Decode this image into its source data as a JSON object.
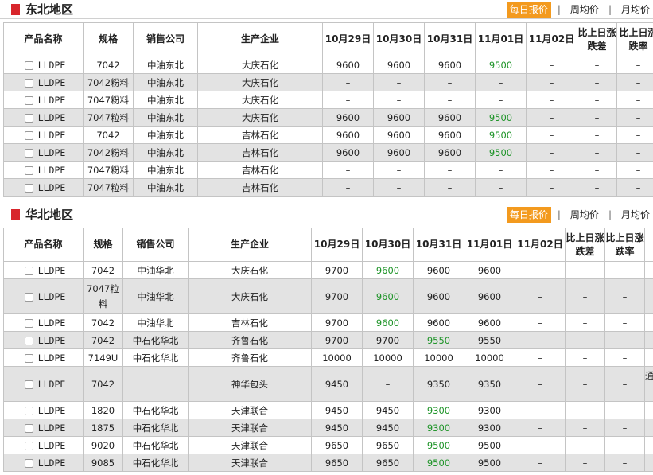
{
  "tabs": {
    "daily": "每日报价",
    "weekly": "周均价",
    "monthly": "月均价",
    "sep": "|"
  },
  "columns": [
    "产品名称",
    "规格",
    "销售公司",
    "生产企业",
    "10月29日",
    "10月30日",
    "10月31日",
    "11月01日",
    "11月02日",
    "比上日涨跌差",
    "比上日涨跌率"
  ],
  "colors": {
    "accent": "#f39a1e",
    "marker": "#d8262c",
    "up_down": "#1e9428",
    "row_alt": "#e3e3e3"
  },
  "sections": [
    {
      "title": "东北地区",
      "rows": [
        {
          "product": "LLDPE",
          "spec": "7042",
          "seller": "中油东北",
          "producer": "大庆石化",
          "d1": "9600",
          "d2": "9600",
          "d3": "9600",
          "d4": "9500",
          "d5": "–",
          "diff": "–",
          "rate": "–"
        },
        {
          "product": "LLDPE",
          "spec": "7042粉料",
          "seller": "中油东北",
          "producer": "大庆石化",
          "d1": "–",
          "d2": "–",
          "d3": "–",
          "d4": "–",
          "d5": "–",
          "diff": "–",
          "rate": "–"
        },
        {
          "product": "LLDPE",
          "spec": "7047粉料",
          "seller": "中油东北",
          "producer": "大庆石化",
          "d1": "–",
          "d2": "–",
          "d3": "–",
          "d4": "–",
          "d5": "–",
          "diff": "–",
          "rate": "–"
        },
        {
          "product": "LLDPE",
          "spec": "7047粒料",
          "seller": "中油东北",
          "producer": "大庆石化",
          "d1": "9600",
          "d2": "9600",
          "d3": "9600",
          "d4": "9500",
          "d5": "–",
          "diff": "–",
          "rate": "–"
        },
        {
          "product": "LLDPE",
          "spec": "7042",
          "seller": "中油东北",
          "producer": "吉林石化",
          "d1": "9600",
          "d2": "9600",
          "d3": "9600",
          "d4": "9500",
          "d5": "–",
          "diff": "–",
          "rate": "–"
        },
        {
          "product": "LLDPE",
          "spec": "7042粉料",
          "seller": "中油东北",
          "producer": "吉林石化",
          "d1": "9600",
          "d2": "9600",
          "d3": "9600",
          "d4": "9500",
          "d5": "–",
          "diff": "–",
          "rate": "–"
        },
        {
          "product": "LLDPE",
          "spec": "7047粉料",
          "seller": "中油东北",
          "producer": "吉林石化",
          "d1": "–",
          "d2": "–",
          "d3": "–",
          "d4": "–",
          "d5": "–",
          "diff": "–",
          "rate": "–"
        },
        {
          "product": "LLDPE",
          "spec": "7047粒料",
          "seller": "中油东北",
          "producer": "吉林石化",
          "d1": "–",
          "d2": "–",
          "d3": "–",
          "d4": "–",
          "d5": "–",
          "diff": "–",
          "rate": "–"
        }
      ]
    },
    {
      "title": "华北地区",
      "rows": [
        {
          "product": "LLDPE",
          "spec": "7042",
          "seller": "中油华北",
          "producer": "大庆石化",
          "d1": "9700",
          "d2": "9600",
          "d3": "9600",
          "d4": "9600",
          "d5": "–",
          "diff": "–",
          "rate": "–"
        },
        {
          "product": "LLDPE",
          "spec": "7047粒料",
          "seller": "中油华北",
          "producer": "大庆石化",
          "d1": "9700",
          "d2": "9600",
          "d3": "9600",
          "d4": "9600",
          "d5": "–",
          "diff": "–",
          "rate": "–"
        },
        {
          "product": "LLDPE",
          "spec": "7042",
          "seller": "中油华北",
          "producer": "吉林石化",
          "d1": "9700",
          "d2": "9600",
          "d3": "9600",
          "d4": "9600",
          "d5": "–",
          "diff": "–",
          "rate": "–"
        },
        {
          "product": "LLDPE",
          "spec": "7042",
          "seller": "中石化华北",
          "producer": "齐鲁石化",
          "d1": "9700",
          "d2": "9700",
          "d3": "9550",
          "d4": "9550",
          "d5": "–",
          "diff": "–",
          "rate": "–"
        },
        {
          "product": "LLDPE",
          "spec": "7149U",
          "seller": "中石化华北",
          "producer": "齐鲁石化",
          "d1": "10000",
          "d2": "10000",
          "d3": "10000",
          "d4": "10000",
          "d5": "–",
          "diff": "–",
          "rate": "–"
        },
        {
          "product": "LLDPE",
          "spec": "7042",
          "seller": "",
          "producer": "神华包头",
          "d1": "9450",
          "d2": "–",
          "d3": "9350",
          "d4": "9350",
          "d5": "–",
          "diff": "–",
          "rate": "–",
          "extra": "通"
        },
        {
          "product": "LLDPE",
          "spec": "1820",
          "seller": "中石化华北",
          "producer": "天津联合",
          "d1": "9450",
          "d2": "9450",
          "d3": "9300",
          "d4": "9300",
          "d5": "–",
          "diff": "–",
          "rate": "–"
        },
        {
          "product": "LLDPE",
          "spec": "1875",
          "seller": "中石化华北",
          "producer": "天津联合",
          "d1": "9450",
          "d2": "9450",
          "d3": "9300",
          "d4": "9300",
          "d5": "–",
          "diff": "–",
          "rate": "–"
        },
        {
          "product": "LLDPE",
          "spec": "9020",
          "seller": "中石化华北",
          "producer": "天津联合",
          "d1": "9650",
          "d2": "9650",
          "d3": "9500",
          "d4": "9500",
          "d5": "–",
          "diff": "–",
          "rate": "–"
        },
        {
          "product": "LLDPE",
          "spec": "9085",
          "seller": "中石化华北",
          "producer": "天津联合",
          "d1": "9650",
          "d2": "9650",
          "d3": "9500",
          "d4": "9500",
          "d5": "–",
          "diff": "–",
          "rate": "–"
        }
      ]
    }
  ]
}
